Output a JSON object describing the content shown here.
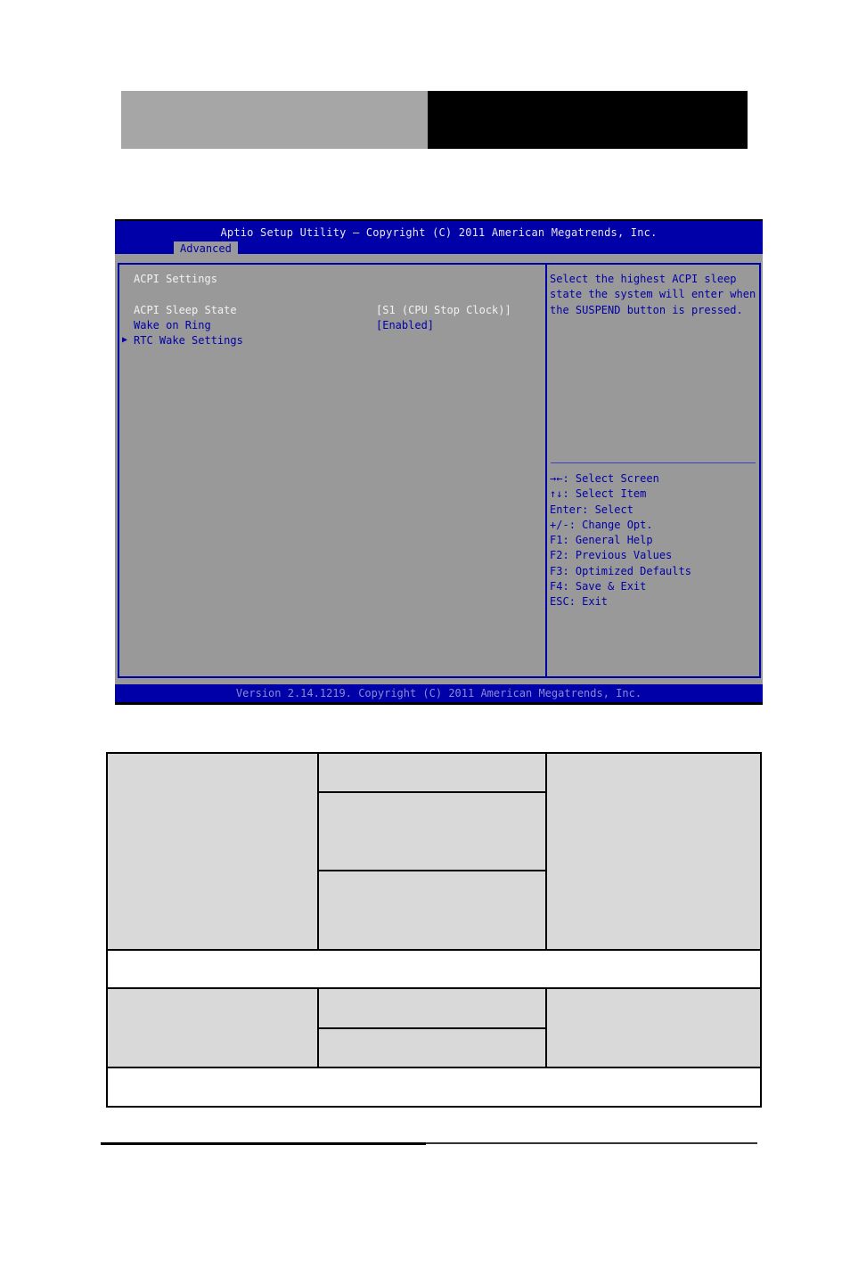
{
  "bios": {
    "title": "Aptio Setup Utility – Copyright (C) 2011 American Megatrends, Inc.",
    "active_tab": "Advanced",
    "section_title": "ACPI Settings",
    "items": [
      {
        "label": "ACPI Sleep State",
        "value": "[S1 (CPU Stop Clock)]",
        "selected": true
      },
      {
        "label": "Wake on Ring",
        "value": "[Enabled]",
        "selected": false
      },
      {
        "label": "RTC Wake Settings",
        "value": "",
        "submenu": true
      }
    ],
    "submenu_icon": "triangle-right-icon",
    "help_text": "Select the highest ACPI sleep state the system will enter when the SUSPEND button is pressed.",
    "keys": [
      {
        "key": "→←",
        "desc": ": Select Screen"
      },
      {
        "key": "↑↓",
        "desc": ": Select Item"
      },
      {
        "key": "Enter",
        "desc": ": Select"
      },
      {
        "key": "+/-",
        "desc": ": Change Opt."
      },
      {
        "key": "F1",
        "desc": ": General Help"
      },
      {
        "key": "F2",
        "desc": ": Previous Values"
      },
      {
        "key": "F3",
        "desc": ": Optimized Defaults"
      },
      {
        "key": "F4",
        "desc": ": Save & Exit"
      },
      {
        "key": "ESC",
        "desc": ": Exit"
      }
    ],
    "version": "Version 2.14.1219. Copyright (C) 2011 American Megatrends, Inc.",
    "colors": {
      "bar_blue": "#0000a8",
      "panel_gray": "#999999",
      "selected_text": "#f2f2f2"
    }
  },
  "options_table": {
    "rows": [
      {
        "cells": [
          "",
          "",
          ""
        ],
        "sub_values": [
          "",
          "",
          ""
        ]
      },
      {
        "note": ""
      },
      {
        "cells": [
          "",
          "",
          ""
        ],
        "sub_values": [
          "",
          ""
        ]
      },
      {
        "note": ""
      }
    ]
  }
}
